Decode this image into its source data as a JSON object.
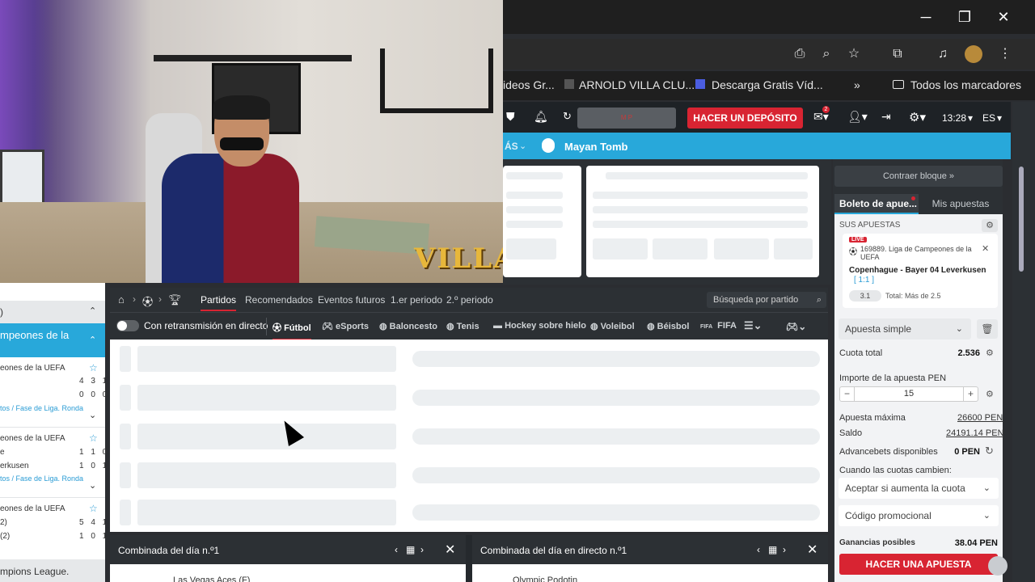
{
  "window": {
    "minimize": "─",
    "restore": "❐",
    "close": "✕"
  },
  "bookmarks": {
    "items": [
      "ideos Gr...",
      "ARNOLD VILLA CLU...",
      "Descarga Gratis Víd..."
    ],
    "more": "»",
    "all_bookmarks": "Todos los marcadores"
  },
  "webcam": {
    "logo_text": "VILLA"
  },
  "site_header": {
    "mp_label": "M P",
    "deposit_button": "HACER UN DEPÓSITO",
    "time": "13:28",
    "language": "ES",
    "badge_count": "2"
  },
  "sport_nav": {
    "more_label": "ÁS",
    "user_name": "Mayan Tomb"
  },
  "center": {
    "tabs": [
      "Partidos",
      "Recomendados",
      "Eventos futuros",
      "1.er periodo",
      "2.º periodo"
    ],
    "search_placeholder": "Búsqueda por partido",
    "live_toggle_label": "Con retransmisión en directo",
    "sports": [
      "Fútbol",
      "eSports",
      "Baloncesto",
      "Tenis",
      "Hockey sobre hielo",
      "Voleibol",
      "Béisbol",
      "FIFA"
    ],
    "fifa_prefix": "FIFA"
  },
  "bottom": {
    "combo1_title": "Combinada del día n.º1",
    "combo2_title": "Combinada del día en directo n.º1",
    "row1_text": "Las Vegas Aces (F)",
    "row2_text": "Olympic Podotin"
  },
  "left_panel": {
    "header_close": ")",
    "active_title": "mpeones de la",
    "events": [
      {
        "league": "eones de la UEFA",
        "team1": "",
        "team2": "",
        "s1": "4 3 1",
        "s2": "0 0 0",
        "link": "tos / Fase de Liga. Ronda"
      },
      {
        "league": "eones de la UEFA",
        "team1": "e",
        "team2": "erkusen",
        "s1": "1 1 0",
        "s2": "1 0 1",
        "link": "tos / Fase de Liga. Ronda"
      },
      {
        "league": "eones de la UEFA",
        "team1": "2)",
        "team2": "(2)",
        "s1": "5 4 1",
        "s2": "1 0 1",
        "link": ""
      }
    ],
    "footer": "mpions League."
  },
  "right_panel": {
    "collapse_block": "Contraer bloque »",
    "tab_ticket": "Boleto de apue...",
    "tab_my_bets": "Mis apuestas",
    "your_bets": "SUS APUESTAS",
    "live_badge": "LIVE",
    "bet_event": "169889. Liga de Campeones de la UEFA",
    "match": "Copenhague - Bayer 04 Leverkusen",
    "score": "[ 1:1 ]",
    "odd": "3.1",
    "bet_type": "Total: Más de 2.5",
    "bet_mode": "Apuesta simple",
    "total_odds_label": "Cuota total",
    "total_odds_value": "2.536",
    "stake_label": "Importe de la apuesta PEN",
    "stake_value": "15",
    "max_bet_label": "Apuesta máxima",
    "max_bet_value": "26600 PEN",
    "balance_label": "Saldo",
    "balance_value": "24191.14 PEN",
    "advancebets_label": "Advancebets disponibles",
    "advancebets_value": "0 PEN",
    "odds_change_label": "Cuando las cuotas cambien:",
    "odds_change_option": "Aceptar si aumenta la cuota",
    "promo_code": "Código promocional",
    "possible_winnings_label": "Ganancias posibles",
    "possible_winnings_value": "38.04 PEN",
    "place_bet_button": "HACER UNA APUESTA"
  },
  "colors": {
    "accent_blue": "#28a8da",
    "deposit_red": "#d82432",
    "dark_bg": "#2c3034"
  }
}
